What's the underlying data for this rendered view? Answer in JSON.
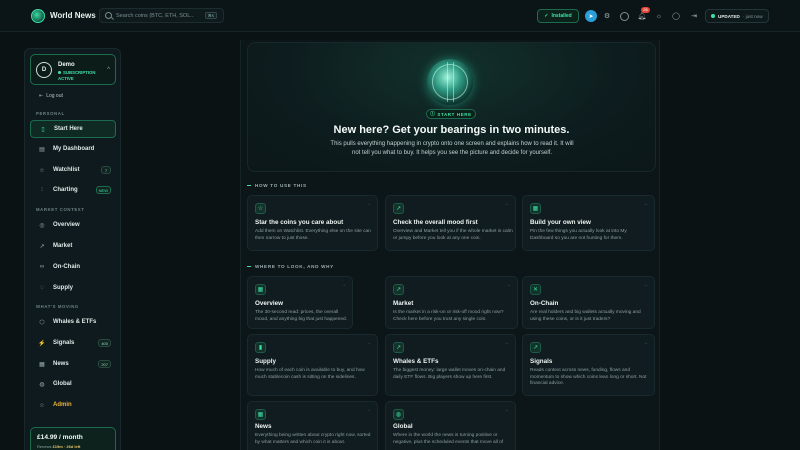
{
  "topbar": {
    "app_name": "World News",
    "search_placeholder": "Search coins (BTC, ETH, SOL...)",
    "search_kbd": "⌘K",
    "installed_label": "Installed",
    "notification_count": "26",
    "updated_label": "UPDATED",
    "updated_ago": "· just now"
  },
  "sidebar": {
    "user": {
      "initial": "D",
      "name": "Demo",
      "status_line1": "SUBSCRIPTION",
      "status_line2": "ACTIVE"
    },
    "logout_label": "Log out",
    "sections": {
      "personal": "PERSONAL",
      "market": "MARKET CONTEXT",
      "moving": "WHAT'S MOVING"
    },
    "items": [
      {
        "label": "Start Here",
        "icon": "book-icon"
      },
      {
        "label": "My Dashboard",
        "icon": "dashboard-icon"
      },
      {
        "label": "Watchlist",
        "icon": "star-icon",
        "badge": "7"
      },
      {
        "label": "Charting",
        "icon": "chart-icon",
        "badge": "NEW"
      },
      {
        "label": "Overview",
        "icon": "target-icon"
      },
      {
        "label": "Market",
        "icon": "trend-icon"
      },
      {
        "label": "On-Chain",
        "icon": "link-icon"
      },
      {
        "label": "Supply",
        "icon": "coins-icon"
      },
      {
        "label": "Whales & ETFs",
        "icon": "shield-icon"
      },
      {
        "label": "Signals",
        "icon": "signal-icon",
        "badge": "400"
      },
      {
        "label": "News",
        "icon": "news-icon",
        "badge": "207"
      },
      {
        "label": "Global",
        "icon": "globe-icon"
      },
      {
        "label": "Admin",
        "icon": "star-outline-icon"
      }
    ],
    "price": {
      "main": "£14.99 / month",
      "sub_a": "Renews",
      "sub_b": "£19m · 26d left"
    }
  },
  "hero": {
    "pill": "START HERE",
    "title": "New here? Get your bearings in two minutes.",
    "desc": "This pulls everything happening in crypto onto one screen and explains how to read it. It will not tell you what to buy. It helps you see the picture and decide for yourself."
  },
  "how_to": {
    "label": "HOW TO USE THIS",
    "cards": [
      {
        "title": "Star the coins you care about",
        "desc": "Add them on Watchlist. Everything else on the site can then narrow to just those.",
        "icon": "star-icon"
      },
      {
        "title": "Check the overall mood first",
        "desc": "Overview and Market tell you if the whole market is calm or jumpy before you look at any one coin.",
        "icon": "trend-icon"
      },
      {
        "title": "Build your own view",
        "desc": "Pin the few things you actually look at into My Dashboard so you are not hunting for them.",
        "icon": "grid-icon"
      }
    ]
  },
  "where_to": {
    "label": "WHERE TO LOOK, AND WHY",
    "cards": [
      {
        "title": "Overview",
        "desc": "The 30-second read: prices, the overall mood, and anything big that just happened.",
        "icon": "grid-icon"
      },
      {
        "title": "Market",
        "desc": "Is the market in a risk-on or risk-off mood right now? Check here before you trust any single coin.",
        "icon": "trend-icon"
      },
      {
        "title": "On-Chain",
        "desc": "Are real holders and big wallets actually moving and using these coins, or is it just traders?",
        "icon": "nodes-icon"
      },
      {
        "title": "Supply",
        "desc": "How much of each coin is available to buy, and how much stablecoin cash is sitting on the sidelines.",
        "icon": "bars-icon"
      },
      {
        "title": "Whales & ETFs",
        "desc": "The biggest money: large wallet moves on-chain and daily ETF flows. Big players show up here first.",
        "icon": "trend-icon"
      },
      {
        "title": "Signals",
        "desc": "Reads context across news, funding, flows and momentum to show which coins lean long or short. Not financial advice.",
        "icon": "signal-icon"
      },
      {
        "title": "News",
        "desc": "Everything being written about crypto right now, sorted by what matters and which coin it is about.",
        "icon": "news-icon"
      },
      {
        "title": "Global",
        "desc": "Where in the world the news is turning positive or negative, plus the scheduled events that move all of",
        "icon": "globe-icon"
      }
    ]
  },
  "colors": {
    "accent": "#3fe0a8",
    "bg": "#0a1214",
    "gold": "#f0b43a",
    "badge_red": "#e0483b"
  }
}
